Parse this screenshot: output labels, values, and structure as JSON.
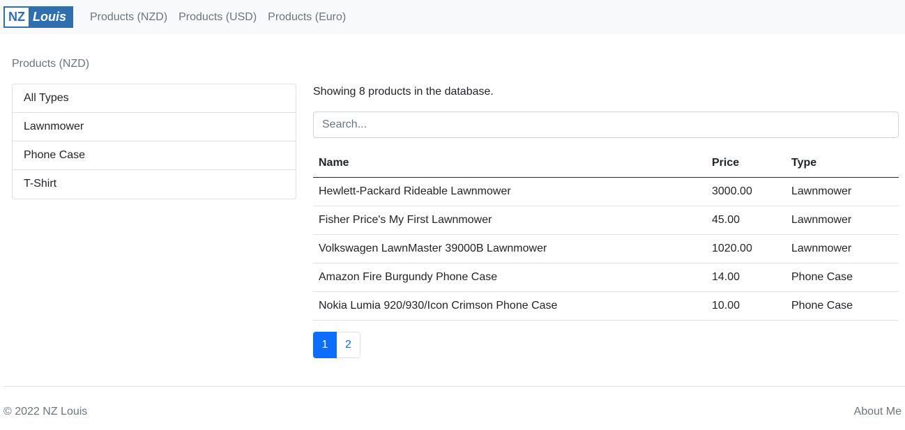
{
  "navbar": {
    "logo_left": "NZ",
    "logo_right": "Louis",
    "links": [
      "Products (NZD)",
      "Products (USD)",
      "Products (Euro)"
    ]
  },
  "page": {
    "heading": "Products (NZD)"
  },
  "types": [
    "All Types",
    "Lawnmower",
    "Phone Case",
    "T-Shirt"
  ],
  "summary": "Showing 8 products in the database.",
  "search": {
    "placeholder": "Search...",
    "value": ""
  },
  "table": {
    "headers": [
      "Name",
      "Price",
      "Type"
    ],
    "rows": [
      [
        "Hewlett-Packard Rideable Lawnmower",
        "3000.00",
        "Lawnmower"
      ],
      [
        "Fisher Price's My First Lawnmower",
        "45.00",
        "Lawnmower"
      ],
      [
        "Volkswagen LawnMaster 39000B Lawnmower",
        "1020.00",
        "Lawnmower"
      ],
      [
        "Amazon Fire Burgundy Phone Case",
        "14.00",
        "Phone Case"
      ],
      [
        "Nokia Lumia 920/930/Icon Crimson Phone Case",
        "10.00",
        "Phone Case"
      ]
    ]
  },
  "pagination": {
    "pages": [
      "1",
      "2"
    ],
    "current": "1"
  },
  "footer": {
    "copyright": "© 2022 NZ Louis",
    "about": "About Me"
  },
  "colors": {
    "accent": "#0d6efd",
    "logo": "#2f6fb0",
    "navbar_bg": "#f8f9fa",
    "muted": "#6c757d"
  }
}
